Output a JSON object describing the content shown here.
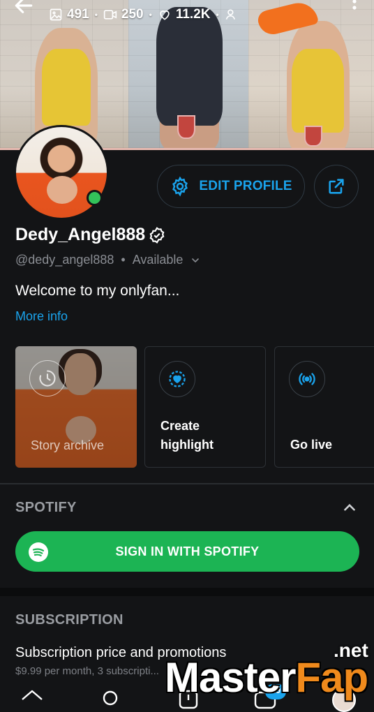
{
  "header": {
    "photos_count": "491",
    "videos_count": "250",
    "likes_count": "11.2K",
    "icons": [
      "back-arrow-icon",
      "image-icon",
      "video-icon",
      "heart-icon",
      "user-icon",
      "more-vert-icon"
    ]
  },
  "actions": {
    "edit_profile_label": "EDIT PROFILE"
  },
  "profile": {
    "name": "Dedy_Angel888",
    "handle": "@dedy_angel888",
    "separator": "•",
    "status": "Available",
    "bio": "Welcome to my onlyfan...",
    "more_info": "More info"
  },
  "stories": [
    {
      "label": "Story archive"
    },
    {
      "label_line1": "Create",
      "label_line2": "highlight"
    },
    {
      "label": "Go live"
    }
  ],
  "spotify": {
    "section_title": "SPOTIFY",
    "button_label": "SIGN IN WITH SPOTIFY"
  },
  "subscription": {
    "section_title": "SUBSCRIPTION",
    "line": "Subscription price and promotions",
    "detail": "$9.99 per month, 3 subscripti..."
  },
  "nav": {
    "badge_count": "29"
  },
  "watermark": {
    "part1": "Master",
    "part2": "Fap",
    "suffix": ".net"
  },
  "colors": {
    "background": "#131416",
    "accent": "#1aa3ec",
    "spotify": "#1cb454",
    "online": "#33c25a"
  }
}
